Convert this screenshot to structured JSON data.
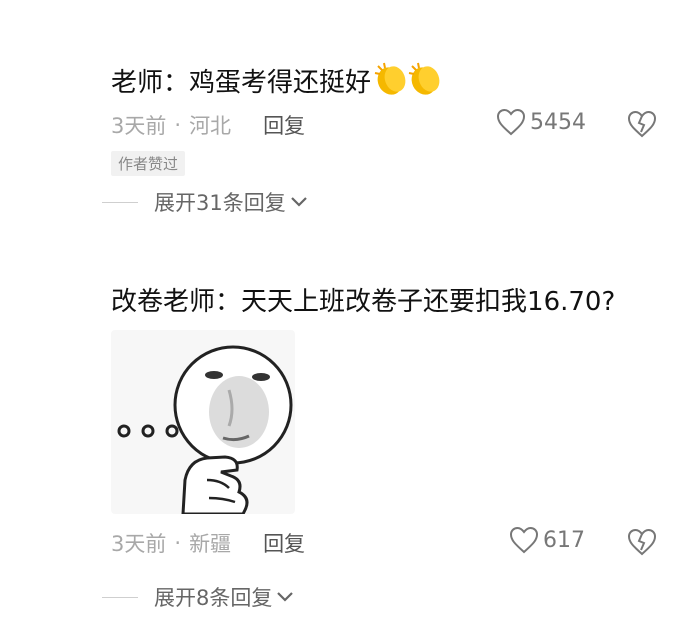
{
  "comments": [
    {
      "author": "老师",
      "separator": "：",
      "content": "鸡蛋考得还挺好",
      "emoji": "clapping-hands-icon",
      "time": "3天前",
      "location": "河北",
      "reply_label": "回复",
      "likes": "5454",
      "badge": "作者赞过",
      "expand_label": "展开31条回复"
    },
    {
      "author": "改卷老师",
      "separator": "：",
      "content": "天天上班改卷子还要扣我16.70?",
      "sticker": "thinking-meme-sticker",
      "time": "3天前",
      "location": "新疆",
      "reply_label": "回复",
      "likes": "617",
      "expand_label": "展开8条回复"
    }
  ],
  "meta_dot": "·",
  "colors": {
    "text": "#111111",
    "meta": "#a8a8a8",
    "reply": "#555555",
    "badge_bg": "#f1f1f1",
    "clap": "#f5b800"
  }
}
